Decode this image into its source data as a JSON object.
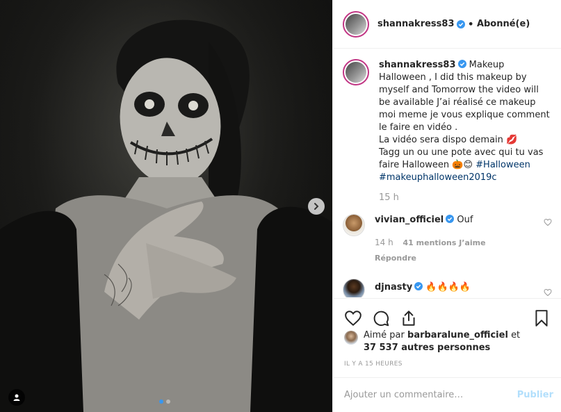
{
  "post": {
    "image_alt": "Halloween makeup photo",
    "image_count": 2,
    "active_index": 0
  },
  "header": {
    "username": "shannakress83",
    "separator": "•",
    "follow_label": "Abonné(e)"
  },
  "caption": {
    "username": "shannakress83",
    "text_before": "Makeup Halloween , I did this makeup by myself and Tomorrow the video will be available J’ai réalisé ce makeup moi meme je vous explique comment le faire en vidéo .",
    "line_video": "La vidéo sera dispo demain 💋",
    "line_tag": "Tagg un ou une pote avec qui tu vas faire Halloween 🎃😊",
    "hashtag1": "#Halloween",
    "hashtag2": "#makeuphalloween2019c",
    "time": "15 h"
  },
  "comments": [
    {
      "username": "vivian_officiel",
      "text": "Ouf",
      "time": "14 h",
      "likes": "41 mentions J’aime",
      "reply_label": "Répondre"
    },
    {
      "username": "djnasty",
      "text": "🔥🔥🔥🔥"
    }
  ],
  "likes": {
    "prefix": "Aimé par",
    "user": "barbaralune_officiel",
    "conj": "et",
    "others": "37 537 autres personnes"
  },
  "timestamp": "IL Y A 15 HEURES",
  "add_comment": {
    "placeholder": "Ajouter un commentaire…",
    "publish_label": "Publier"
  },
  "colors": {
    "verified": "#3897f0",
    "link": "#003569",
    "muted": "#999999",
    "publish_disabled": "#b2dffc",
    "avatar_ring": "#c13584"
  }
}
